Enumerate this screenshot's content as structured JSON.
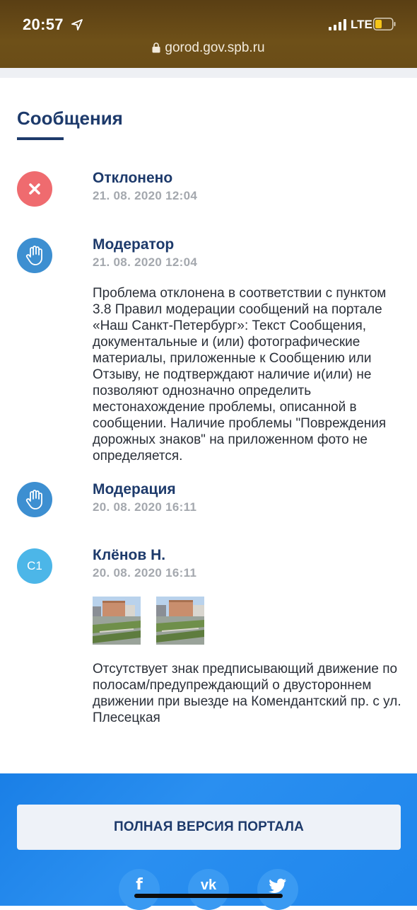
{
  "status_bar": {
    "time": "20:57",
    "network": "LTE",
    "url": "gorod.gov.spb.ru"
  },
  "section": {
    "title": "Сообщения"
  },
  "messages": [
    {
      "author": "Отклонено",
      "date": "21. 08. 2020 12:04",
      "icon": "close-icon",
      "avatar_color": "#ef6b6f"
    },
    {
      "author": "Модератор",
      "date": "21. 08. 2020 12:04",
      "icon": "hand-icon",
      "avatar_color": "#3d8fd1",
      "text": "Проблема отклонена в соответствии с пунктом 3.8 Правил модерации сообщений на портале «Наш Санкт-Петербург»: Текст Сообщения, документальные и (или) фотографические материалы, приложенные к Сообщению или Отзыву, не подтверждают наличие и(или) не позволяют однозначно определить местонахождение проблемы, описанной в сообщении. Наличие проблемы \"Повреждения дорожных знаков\" на приложенном фото не определяется."
    },
    {
      "author": "Модерация",
      "date": "20. 08. 2020 16:11",
      "icon": "hand-icon",
      "avatar_color": "#3d8fd1"
    },
    {
      "author": "Клёнов Н.",
      "date": "20. 08. 2020 16:11",
      "avatar_initials": "С1",
      "avatar_color": "#4cb6e8",
      "text": "Отсутствует знак предписывающий движение по полосам/предупреждающий о двустороннем движении при выезде на Комендантский пр. с ул. Плесецкая"
    }
  ],
  "footer": {
    "portal_button": "ПОЛНАЯ ВЕРСИЯ ПОРТАЛА",
    "social": [
      {
        "name": "facebook",
        "glyph": "f"
      },
      {
        "name": "vk",
        "glyph": "vk"
      },
      {
        "name": "twitter",
        "glyph": "twitter-icon"
      }
    ]
  }
}
